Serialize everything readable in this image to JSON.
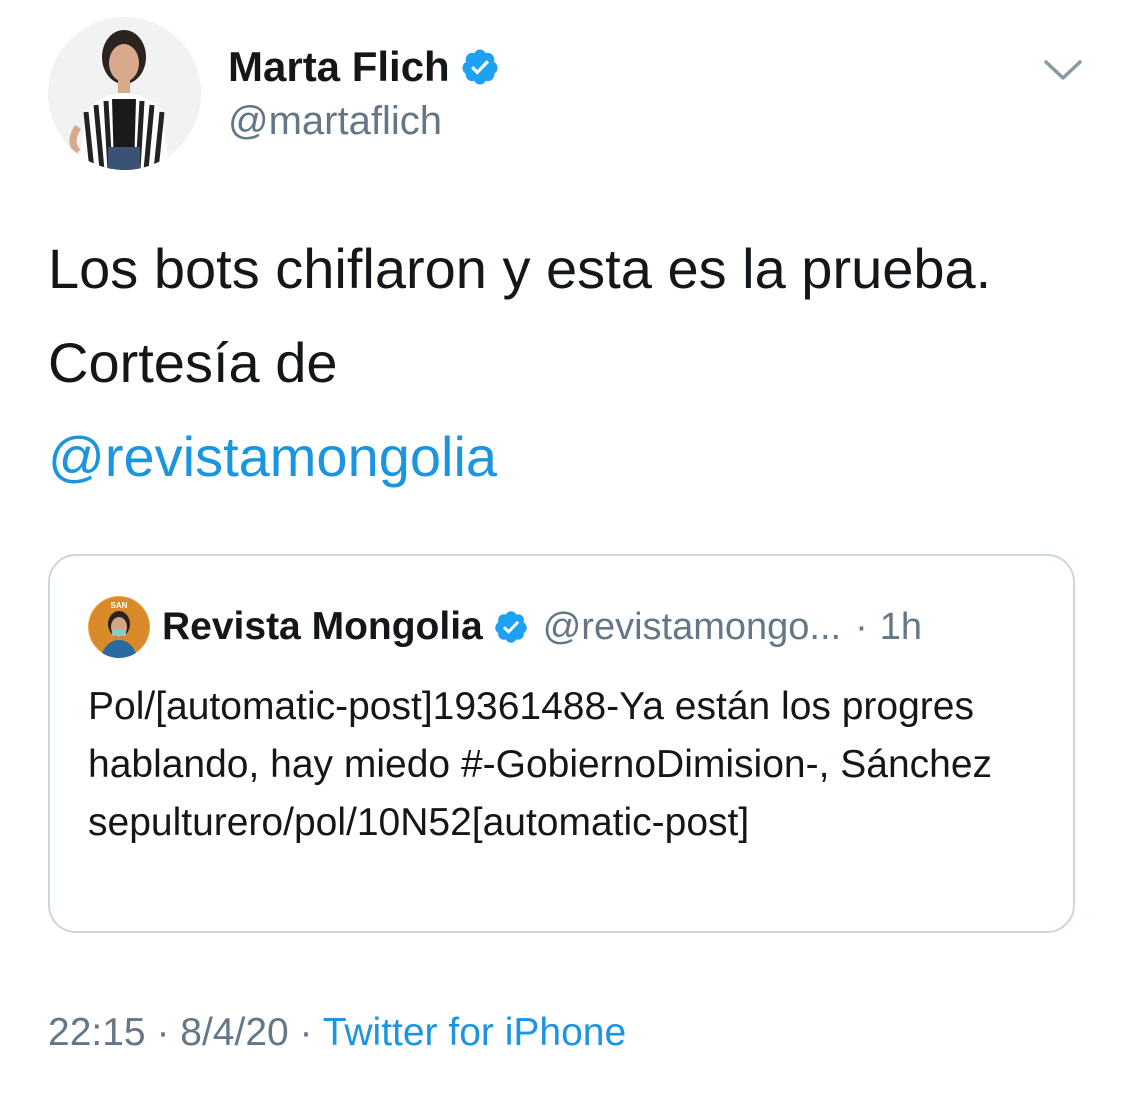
{
  "author": {
    "name": "Marta Flich",
    "handle": "@martaflich",
    "avatar_icon": "profile-photo",
    "verified_icon": "verified-badge-icon"
  },
  "menu": {
    "icon": "chevron-down-icon"
  },
  "tweet": {
    "text": "Los bots chiflaron y esta es la prueba. Cortesía de",
    "mention": "@revistamongolia"
  },
  "quote": {
    "name": "Revista Mongolia",
    "handle": "@revistamongo...",
    "separator": "·",
    "time": "1h",
    "text": "Pol/[automatic-post]19361488-Ya están los progres hablando, hay miedo #-GobiernoDimision-, Sánchez sepulturero/pol/10N52[automatic-post]"
  },
  "meta": {
    "time": "22:15",
    "separator1": " · ",
    "date": "8/4/20",
    "separator2": " · ",
    "source": "Twitter for iPhone"
  },
  "colors": {
    "link": "#1b95e0",
    "verified": "#1da1f2",
    "secondary_text": "#657786",
    "border": "#ccd6dd"
  }
}
